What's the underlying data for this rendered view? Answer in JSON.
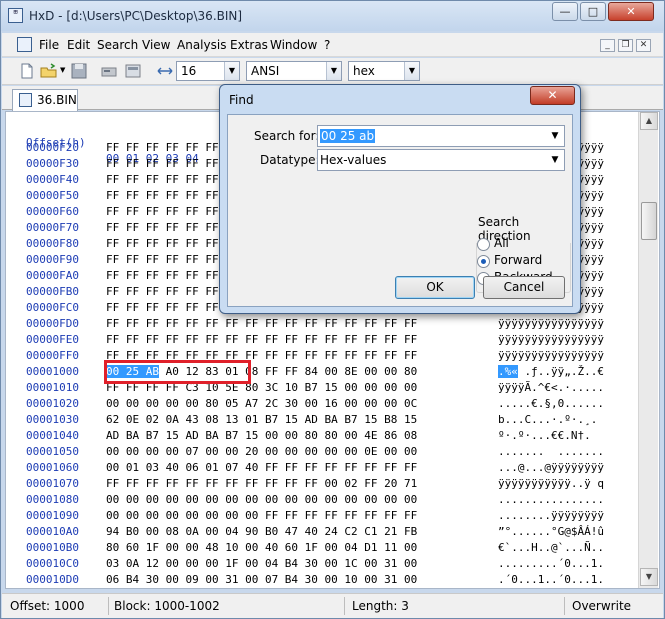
{
  "window": {
    "title": "HxD - [d:\\Users\\PC\\Desktop\\36.BIN]",
    "min_glyph": "—",
    "max_glyph": "□",
    "close_glyph": "✕"
  },
  "menu": {
    "items": [
      "File",
      "Edit",
      "Search",
      "View",
      "Analysis",
      "Extras",
      "Window",
      "?"
    ],
    "mdi_min": "_",
    "mdi_restore": "❐",
    "mdi_close": "✕"
  },
  "toolbar": {
    "bytes_per_row": "16",
    "charset": "ANSI",
    "offset_base": "hex",
    "arrow": "▼"
  },
  "tab": {
    "label": "36.BIN"
  },
  "editor": {
    "header_label": "Offset(h)",
    "header_columns": "00 01 02 03 04",
    "rows": [
      {
        "offset": "00000F20",
        "bytes": "FF FF FF FF FF FF FF FF FF FF FF FF FF FF FF FF",
        "ascii": "ÿÿÿÿÿÿÿÿÿÿÿÿÿÿÿÿ"
      },
      {
        "offset": "00000F30",
        "bytes": "FF FF FF FF FF FF FF FF FF FF FF FF FF FF FF FF",
        "ascii": "ÿÿÿÿÿÿÿÿÿÿÿÿÿÿÿÿ"
      },
      {
        "offset": "00000F40",
        "bytes": "FF FF FF FF FF FF FF FF FF FF FF FF FF FF FF FF",
        "ascii": "ÿÿÿÿÿÿÿÿÿÿÿÿÿÿÿÿ"
      },
      {
        "offset": "00000F50",
        "bytes": "FF FF FF FF FF FF FF FF FF FF FF FF FF FF FF FF",
        "ascii": "ÿÿÿÿÿÿÿÿÿÿÿÿÿÿÿÿ"
      },
      {
        "offset": "00000F60",
        "bytes": "FF FF FF FF FF FF FF FF FF FF FF FF FF FF FF FF",
        "ascii": "ÿÿÿÿÿÿÿÿÿÿÿÿÿÿÿÿ"
      },
      {
        "offset": "00000F70",
        "bytes": "FF FF FF FF FF FF FF FF FF FF FF FF FF FF FF FF",
        "ascii": "ÿÿÿÿÿÿÿÿÿÿÿÿÿÿÿÿ"
      },
      {
        "offset": "00000F80",
        "bytes": "FF FF FF FF FF FF FF FF FF FF FF FF FF FF FF FF",
        "ascii": "ÿÿÿÿÿÿÿÿÿÿÿÿÿÿÿÿ"
      },
      {
        "offset": "00000F90",
        "bytes": "FF FF FF FF FF FF FF FF FF FF FF FF FF FF FF FF",
        "ascii": "ÿÿÿÿÿÿÿÿÿÿÿÿÿÿÿÿ"
      },
      {
        "offset": "00000FA0",
        "bytes": "FF FF FF FF FF FF FF FF FF FF FF FF FF FF FF FF",
        "ascii": "ÿÿÿÿÿÿÿÿÿÿÿÿÿÿÿÿ"
      },
      {
        "offset": "00000FB0",
        "bytes": "FF FF FF FF FF FF FF FF FF FF FF FF FF FF FF FF",
        "ascii": "ÿÿÿÿÿÿÿÿÿÿÿÿÿÿÿÿ"
      },
      {
        "offset": "00000FC0",
        "bytes": "FF FF FF FF FF FF FF FF FF FF FF FF FF FF FF FF",
        "ascii": "ÿÿÿÿÿÿÿÿÿÿÿÿÿÿÿÿ"
      },
      {
        "offset": "00000FD0",
        "bytes": "FF FF FF FF FF FF FF FF FF FF FF FF FF FF FF FF",
        "ascii": "ÿÿÿÿÿÿÿÿÿÿÿÿÿÿÿÿ"
      },
      {
        "offset": "00000FE0",
        "bytes": "FF FF FF FF FF FF FF FF FF FF FF FF FF FF FF FF",
        "ascii": "ÿÿÿÿÿÿÿÿÿÿÿÿÿÿÿÿ"
      },
      {
        "offset": "00000FF0",
        "bytes": "FF FF FF FF FF FF FF FF FF FF FF FF FF FF FF FF",
        "ascii": "ÿÿÿÿÿÿÿÿÿÿÿÿÿÿÿÿ"
      },
      {
        "offset": "00001000",
        "sel": "00 25 AB",
        "bytes": " A0 12 83 01 08 FF FF 84 00 8E 00 00 80",
        "sel_ascii": ".%«",
        "ascii": " .ƒ..ÿÿ„.Ž..€"
      },
      {
        "offset": "00001010",
        "bytes": "FF FF FF FF C3 10 5E 80 3C 10 B7 15 00 00 00 00",
        "ascii": "ÿÿÿÿÃ.^€<.·....."
      },
      {
        "offset": "00001020",
        "bytes": "00 00 00 00 00 80 05 A7 2C 30 00 16 00 00 00 0C",
        "ascii": ".....€.§,0......"
      },
      {
        "offset": "00001030",
        "bytes": "62 0E 02 0A 43 08 13 01 B7 15 AD BA B7 15 B8 15",
        "ascii": "b...C...·.­º·.¸."
      },
      {
        "offset": "00001040",
        "bytes": "AD BA B7 15 AD BA B7 15 00 00 80 80 00 4E 86 08",
        "ascii": "­º·.­º·...€€.N†."
      },
      {
        "offset": "00001050",
        "bytes": "00 00 00 00 07 00 00 20 00 00 00 00 00 0E 00 00",
        "ascii": ".......  ......."
      },
      {
        "offset": "00001060",
        "bytes": "00 01 03 40 06 01 07 40 FF FF FF FF FF FF FF FF",
        "ascii": "...@...@ÿÿÿÿÿÿÿÿ"
      },
      {
        "offset": "00001070",
        "bytes": "FF FF FF FF FF FF FF FF FF FF FF 00 02 FF 20 71",
        "ascii": "ÿÿÿÿÿÿÿÿÿÿÿ..ÿ q"
      },
      {
        "offset": "00001080",
        "bytes": "00 00 00 00 00 00 00 00 00 00 00 00 00 00 00 00",
        "ascii": "................"
      },
      {
        "offset": "00001090",
        "bytes": "00 00 00 00 00 00 00 00 FF FF FF FF FF FF FF FF",
        "ascii": "........ÿÿÿÿÿÿÿÿ"
      },
      {
        "offset": "000010A0",
        "bytes": "94 B0 00 08 0A 00 04 90 B0 47 40 24 C2 C1 21 FB",
        "ascii": "”°......°G@$ÂÁ!û"
      },
      {
        "offset": "000010B0",
        "bytes": "80 60 1F 00 00 48 10 00 40 60 1F 00 04 D1 11 00",
        "ascii": "€`...H..@`...Ñ.."
      },
      {
        "offset": "000010C0",
        "bytes": "03 0A 12 00 00 00 1F 00 04 B4 30 00 1C 00 31 00",
        "ascii": ".........´0...1."
      },
      {
        "offset": "000010D0",
        "bytes": "06 B4 30 00 09 00 31 00 07 B4 30 00 10 00 31 00",
        "ascii": ".´0...1..´0...1."
      }
    ],
    "scroll_up": "▲",
    "scroll_down": "▼"
  },
  "statusbar": {
    "offset": "Offset: 1000",
    "block": "Block: 1000-1002",
    "length": "Length: 3",
    "mode": "Overwrite"
  },
  "find_dialog": {
    "title": "Find",
    "close_glyph": "✕",
    "search_for_label": "Search for:",
    "search_for_value": "00 25 ab",
    "datatype_label": "Datatype:",
    "datatype_value": "Hex-values",
    "direction_label": "Search direction",
    "dir_all": "All",
    "dir_forward": "Forward",
    "dir_backward": "Backward",
    "selected_direction": "Forward",
    "ok_label": "OK",
    "cancel_label": "Cancel",
    "arrow": "▼"
  }
}
